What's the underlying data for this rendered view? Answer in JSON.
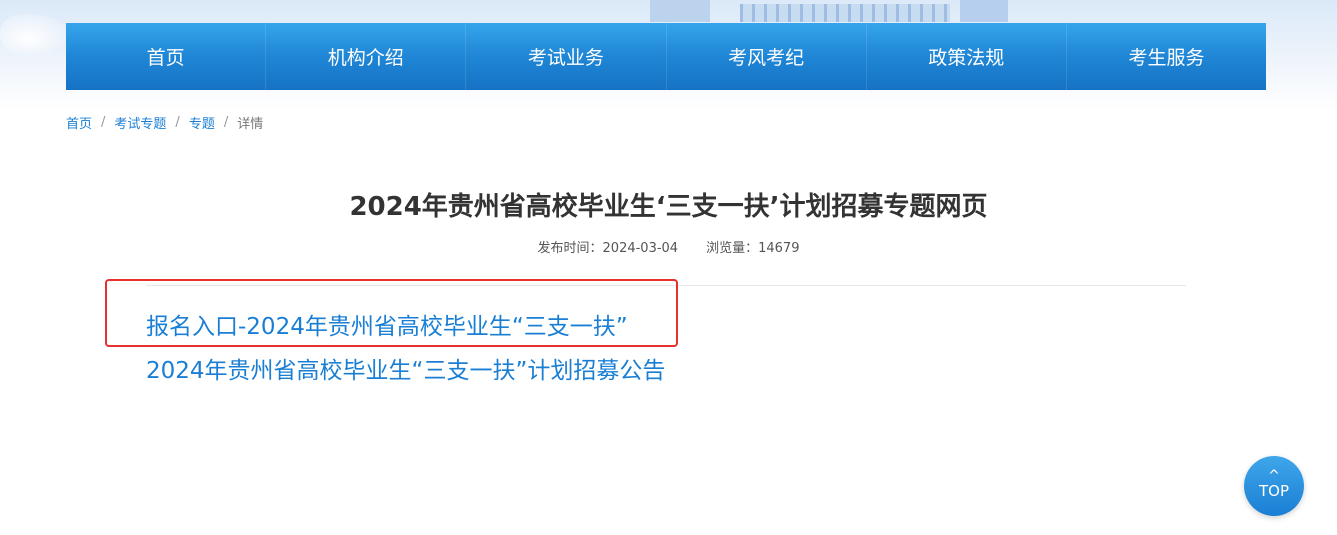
{
  "nav": {
    "items": [
      "首页",
      "机构介绍",
      "考试业务",
      "考风考纪",
      "政策法规",
      "考生服务"
    ]
  },
  "breadcrumb": {
    "items": [
      "首页",
      "考试专题",
      "专题"
    ],
    "current": "详情",
    "separator": "/"
  },
  "article": {
    "title": "2024年贵州省高校毕业生‘三支一扶’计划招募专题网页",
    "publish_label": "发布时间：",
    "publish_date": "2024-03-04",
    "views_label": "浏览量：",
    "views": "14679"
  },
  "links": [
    "报名入口-2024年贵州省高校毕业生“三支一扶”",
    "2024年贵州省高校毕业生“三支一扶”计划招募公告"
  ],
  "back_to_top": {
    "arrow": "^",
    "label": "TOP"
  },
  "colors": {
    "nav_blue": "#1f86d6",
    "link_blue": "#1a7fd4",
    "highlight_red": "#e8312f"
  }
}
